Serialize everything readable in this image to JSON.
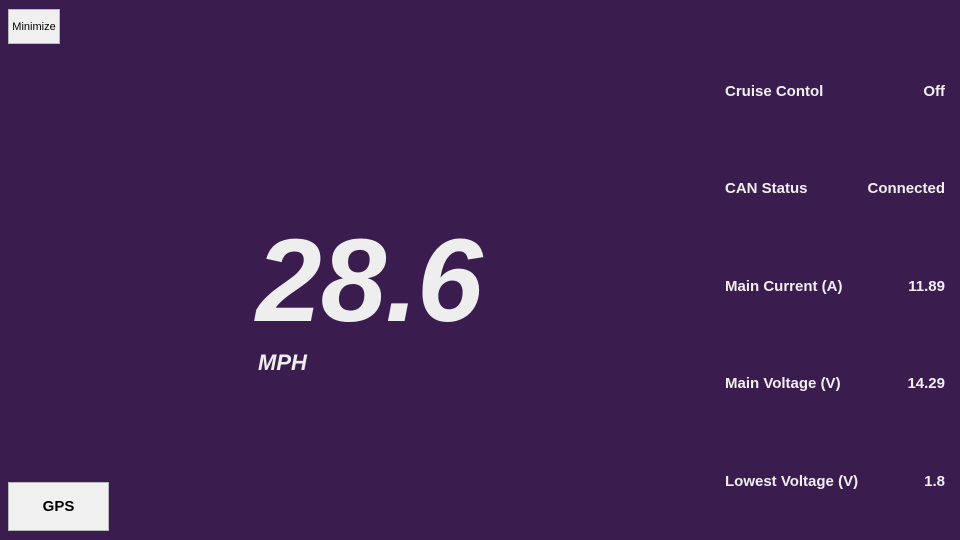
{
  "buttons": {
    "minimize": "Minimize",
    "gps": "GPS"
  },
  "speed": {
    "value": "28.6",
    "unit": "MPH"
  },
  "status": [
    {
      "label": "Cruise Contol",
      "value": "Off"
    },
    {
      "label": "CAN Status",
      "value": "Connected"
    },
    {
      "label": "Main Current (A)",
      "value": "11.89"
    },
    {
      "label": "Main Voltage (V)",
      "value": "14.29"
    },
    {
      "label": "Lowest Voltage (V)",
      "value": "1.8"
    }
  ],
  "colors": {
    "background": "#3a1c4e",
    "text": "#efefef",
    "button_bg": "#f0f0f0"
  }
}
